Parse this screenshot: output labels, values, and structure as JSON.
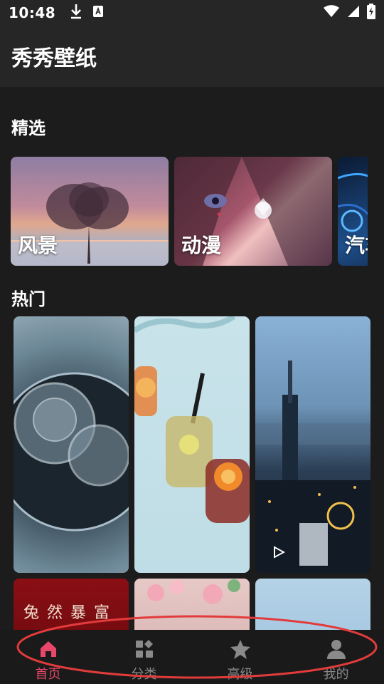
{
  "status_bar": {
    "time": "10:48"
  },
  "app_bar": {
    "title": "秀秀壁纸"
  },
  "featured": {
    "title": "精选",
    "items": [
      {
        "label": "风景"
      },
      {
        "label": "动漫"
      },
      {
        "label": "汽车"
      }
    ]
  },
  "popular": {
    "title": "热门",
    "tile_text": "兔 然 暴 富"
  },
  "nav": {
    "items": [
      {
        "label": "首页",
        "icon": "home-icon"
      },
      {
        "label": "分类",
        "icon": "category-icon"
      },
      {
        "label": "高级",
        "icon": "star-icon"
      },
      {
        "label": "我的",
        "icon": "person-icon"
      }
    ],
    "active_index": 0
  },
  "colors": {
    "accent": "#e8476a",
    "background": "#1c1c1c",
    "bar": "#262626",
    "annotation": "#e23b3b"
  }
}
